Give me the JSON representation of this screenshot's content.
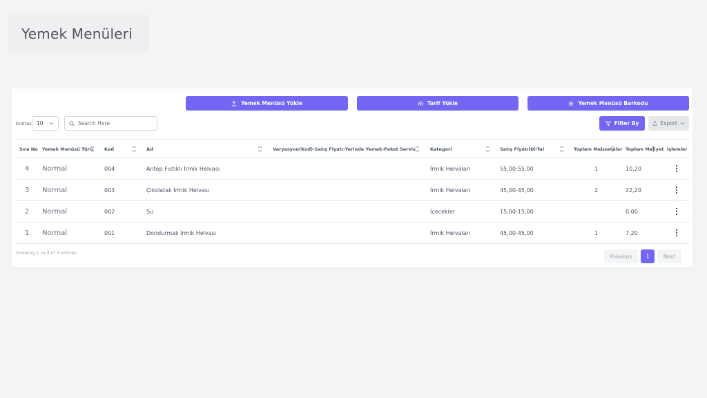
{
  "page_title": "Yemek Menüleri",
  "toolbar": {
    "upload_menu_label": "Yemek Menüsü Yükle",
    "upload_recipe_label": "Tarif Yükle",
    "barcode_label": "Yemek Menüsü Barkodu",
    "entries_label": "Entries",
    "entries_value": "10",
    "search_placeholder": "Search Here",
    "filter_label": "Filter By",
    "export_label": "Export"
  },
  "table": {
    "headers": {
      "sira": "Sıra No",
      "tur": "Yemek Menüsü Türü",
      "kod": "Kod",
      "ad": "Ad",
      "varyasyon": "Varyasyon(Kod)-Satış Fiyatı:Yerinde Yemek-Paket Servis",
      "kategori": "Kategori",
      "fiyat": "Satış Fiyatı(Di-Ta)",
      "malzeme": "Toplam Malzemeler",
      "maliyet": "Toplam Maliyet",
      "islemler": "İşlemler"
    },
    "rows": [
      {
        "sira": "4",
        "tur": "Normal",
        "kod": "004",
        "ad": "Antep Fıstıklı İrmik Helvası",
        "kategori": "İrmik Helvaları",
        "fiyat": "55,00-55,00",
        "malzeme": "1",
        "maliyet": "10,20"
      },
      {
        "sira": "3",
        "tur": "Normal",
        "kod": "003",
        "ad": "Çikolatalı İrmik Helvası",
        "kategori": "İrmik Helvaları",
        "fiyat": "45,00-45,00",
        "malzeme": "2",
        "maliyet": "22,20"
      },
      {
        "sira": "2",
        "tur": "Normal",
        "kod": "002",
        "ad": "Su",
        "kategori": "İçecekler",
        "fiyat": "15,00-15,00",
        "malzeme": "",
        "maliyet": "0,00"
      },
      {
        "sira": "1",
        "tur": "Normal",
        "kod": "001",
        "ad": "Dondurmalı İrmik Helvası",
        "kategori": "İrmik Helvaları",
        "fiyat": "45,00-45,00",
        "malzeme": "1",
        "maliyet": "7,20"
      }
    ]
  },
  "footer": {
    "showing": "Showing 1 to 4 of 4 entries",
    "previous": "Previous",
    "page": "1",
    "next": "Next"
  },
  "colors": {
    "accent": "#7366f0",
    "background": "#f3f4f6"
  },
  "icons": {
    "upload_menu": "upload-icon",
    "upload_recipe": "cloud-upload-icon",
    "barcode": "gear-icon",
    "search": "search-icon",
    "filter": "filter-icon",
    "export": "export-icon",
    "row_actions": "kebab-menu-icon"
  }
}
